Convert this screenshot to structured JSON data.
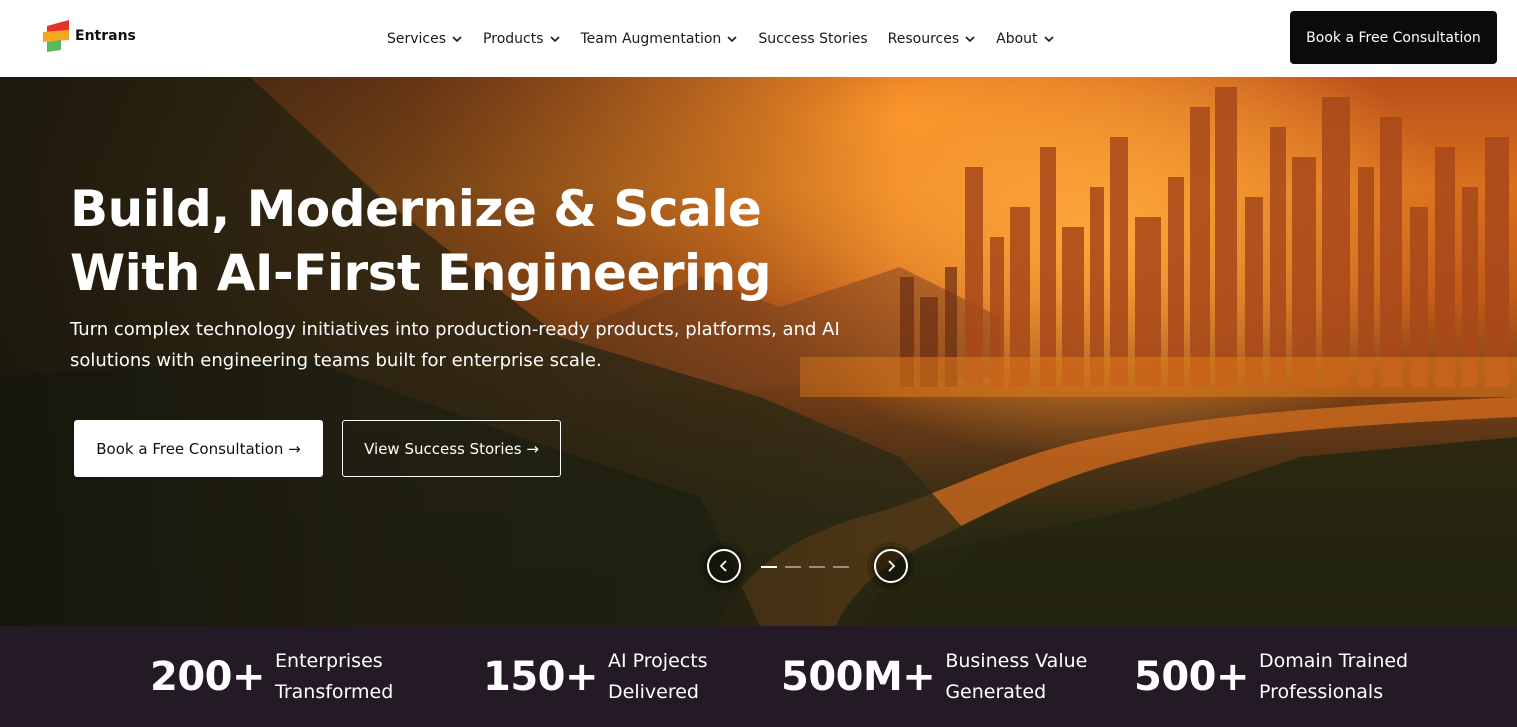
{
  "brand": {
    "name": "Entrans"
  },
  "nav": {
    "items": [
      {
        "label": "Services",
        "has_dropdown": true
      },
      {
        "label": "Products",
        "has_dropdown": true
      },
      {
        "label": "Team Augmentation",
        "has_dropdown": true
      },
      {
        "label": "Success Stories",
        "has_dropdown": false
      },
      {
        "label": "Resources",
        "has_dropdown": true
      },
      {
        "label": "About",
        "has_dropdown": true
      }
    ],
    "cta_label": "Book a Free Consultation"
  },
  "hero": {
    "title": "Build, Modernize & Scale With AI-First Engineering",
    "subtitle": "Turn complex technology initiatives into production-ready products, platforms, and AI solutions with engineering teams built for enterprise scale.",
    "primary_button": "Book a Free Consultation →",
    "secondary_button": "View Success Stories →",
    "carousel": {
      "slide_count": 4,
      "active_index": 0
    }
  },
  "stats": [
    {
      "value": "200+",
      "label_line1": "Enterprises",
      "label_line2": "Transformed"
    },
    {
      "value": "150+",
      "label_line1": "AI Projects",
      "label_line2": "Delivered"
    },
    {
      "value": "500M+",
      "label_line1": "Business Value",
      "label_line2": "Generated"
    },
    {
      "value": "500+",
      "label_line1": "Domain Trained",
      "label_line2": "Professionals"
    }
  ],
  "colors": {
    "header_bg": "#ffffff",
    "cta_bg": "#0b0b0b",
    "stats_bg": "#231a26",
    "logo_red": "#e5322d",
    "logo_orange": "#f5a623",
    "logo_green": "#5cb85c"
  }
}
